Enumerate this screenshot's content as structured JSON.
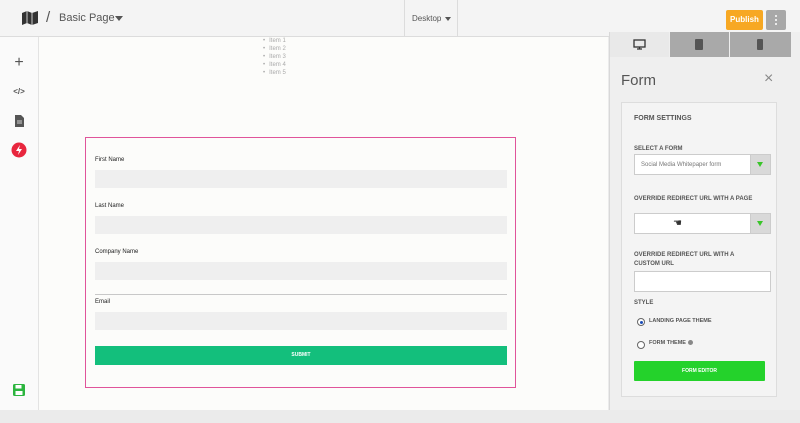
{
  "header": {
    "separator": "/",
    "page_name": "Basic Page",
    "device": "Desktop",
    "publish_label": "Publish",
    "icons": {
      "map": "map-icon",
      "more": "more-vertical-icon"
    }
  },
  "sidebar": {
    "items": [
      {
        "icon": "plus-icon",
        "glyph": "+"
      },
      {
        "icon": "code-icon",
        "glyph": "</>"
      },
      {
        "icon": "document-icon",
        "glyph": ""
      },
      {
        "icon": "lightning-icon",
        "glyph": ""
      },
      {
        "icon": "save-icon",
        "glyph": ""
      }
    ]
  },
  "canvas": {
    "list_items": [
      "Item 1",
      "Item 2",
      "Item 3",
      "Item 4",
      "Item 5"
    ],
    "form": {
      "fields": [
        {
          "label": "First Name"
        },
        {
          "label": "Last Name"
        },
        {
          "label": "Company Name"
        },
        {
          "label": "Email"
        }
      ],
      "submit_label": "SUBMIT"
    }
  },
  "panel": {
    "tabs": [
      "desktop-icon",
      "tablet-icon",
      "mobile-icon"
    ],
    "title": "Form",
    "close_glyph": "×",
    "settings_title": "FORM SETTINGS",
    "select_form_label": "SELECT A FORM",
    "select_form_value": "Social Media Whitepaper form",
    "override_page_label": "OVERRIDE REDIRECT URL WITH A PAGE",
    "override_page_value": "",
    "override_url_label": "OVERRIDE REDIRECT URL WITH A CUSTOM URL",
    "override_url_value": "",
    "style_label": "STYLE",
    "style_options": [
      {
        "label": "LANDING PAGE THEME",
        "selected": true
      },
      {
        "label": "FORM THEME",
        "selected": false
      }
    ],
    "form_editor_label": "FORM EDITOR"
  },
  "colors": {
    "publish": "#f7a823",
    "submit": "#13bf7c",
    "form_editor": "#24d22b",
    "form_outline": "#e0549a",
    "lightning": "#e8263e",
    "save": "#2cb53f"
  }
}
